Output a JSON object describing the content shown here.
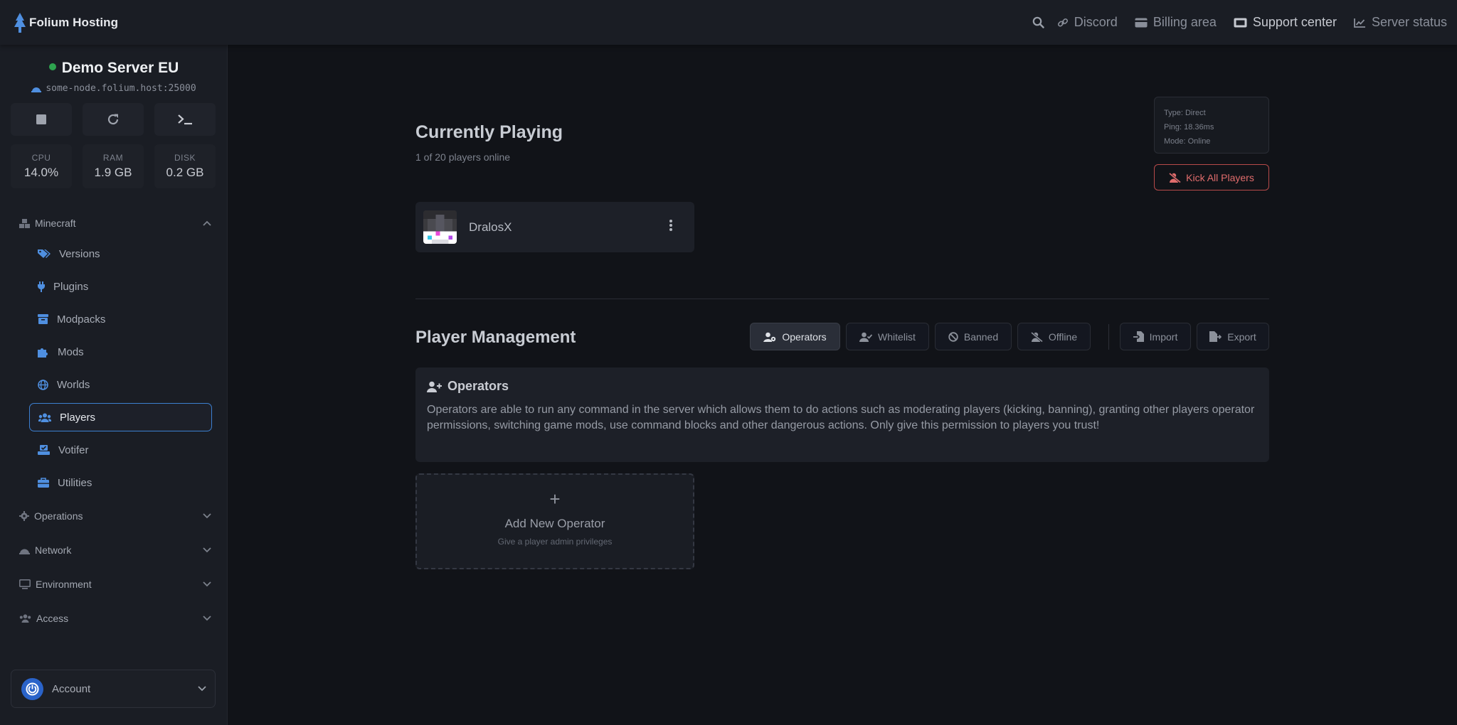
{
  "brand": {
    "name": "Folium Hosting"
  },
  "topnav": {
    "links": [
      {
        "label": "Discord"
      },
      {
        "label": "Billing area"
      },
      {
        "label": "Support center"
      },
      {
        "label": "Server status"
      }
    ]
  },
  "server": {
    "name": "Demo Server EU",
    "host": "some-node.folium.host:25000",
    "status_color": "#2ea44f"
  },
  "stats": {
    "cpu": {
      "label": "CPU",
      "value": "14.0%"
    },
    "ram": {
      "label": "RAM",
      "value": "1.9 GB"
    },
    "disk": {
      "label": "DISK",
      "value": "0.2 GB"
    }
  },
  "sidebar": {
    "minecraft": {
      "label": "Minecraft",
      "items": [
        {
          "label": "Versions",
          "icon": "tags-icon"
        },
        {
          "label": "Plugins",
          "icon": "plug-icon"
        },
        {
          "label": "Modpacks",
          "icon": "box-icon"
        },
        {
          "label": "Mods",
          "icon": "puzzle-icon"
        },
        {
          "label": "Worlds",
          "icon": "globe-icon"
        },
        {
          "label": "Players",
          "icon": "users-icon"
        },
        {
          "label": "Votifer",
          "icon": "vote-icon"
        },
        {
          "label": "Utilities",
          "icon": "toolbox-icon"
        }
      ]
    },
    "sections": [
      {
        "label": "Operations"
      },
      {
        "label": "Network"
      },
      {
        "label": "Environment"
      },
      {
        "label": "Access"
      }
    ],
    "account": {
      "label": "Account"
    }
  },
  "playing": {
    "title": "Currently Playing",
    "subtitle": "1 of 20 players online",
    "info": {
      "type": "Type: Direct",
      "ping": "Ping: 18.36ms",
      "mode": "Mode: Online"
    },
    "kick_label": "Kick All Players",
    "players": [
      {
        "name": "DralosX"
      }
    ]
  },
  "management": {
    "title": "Player Management",
    "tabs": [
      {
        "label": "Operators"
      },
      {
        "label": "Whitelist"
      },
      {
        "label": "Banned"
      },
      {
        "label": "Offline"
      }
    ],
    "actions": [
      {
        "label": "Import"
      },
      {
        "label": "Export"
      }
    ],
    "operators": {
      "title": "Operators",
      "description": "Operators are able to run any command in the server which allows them to do actions such as moderating players (kicking, banning), granting other players operator permissions, switching game mods, use command blocks and other dangerous actions. Only give this permission to players you trust!",
      "add_title": "Add New Operator",
      "add_subtitle": "Give a player admin privileges"
    }
  },
  "colors": {
    "accent": "#3c7fd0",
    "danger": "#e06c6c",
    "icon_blue": "#4f8fe0"
  }
}
